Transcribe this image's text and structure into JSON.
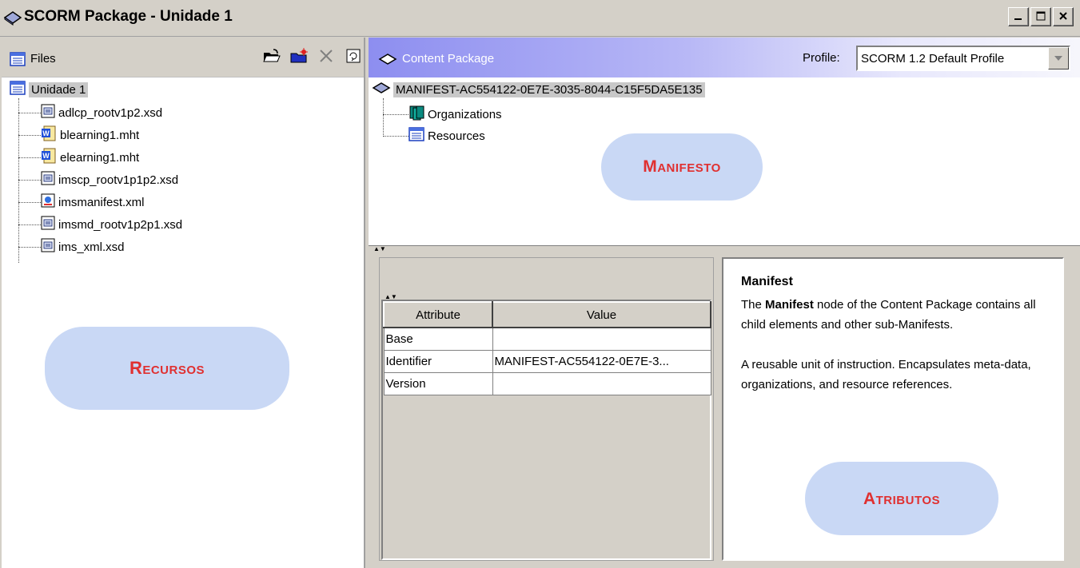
{
  "window": {
    "title": "SCORM Package - Unidade 1",
    "controls": [
      "minimize",
      "maximize",
      "close"
    ]
  },
  "files_panel": {
    "header_label": "Files",
    "toolbar": [
      "import-folder-icon",
      "new-folder-icon",
      "delete-icon",
      "refresh-icon"
    ],
    "root": "Unidade 1",
    "items": [
      {
        "name": "adlcp_rootv1p2.xsd",
        "icon": "xsd-file-icon"
      },
      {
        "name": "blearning1.mht",
        "icon": "word-doc-icon"
      },
      {
        "name": "elearning1.mht",
        "icon": "word-doc-icon"
      },
      {
        "name": "imscp_rootv1p1p2.xsd",
        "icon": "xsd-file-icon"
      },
      {
        "name": "imsmanifest.xml",
        "icon": "xml-file-icon"
      },
      {
        "name": "imsmd_rootv1p2p1.xsd",
        "icon": "xsd-file-icon"
      },
      {
        "name": "ims_xml.xsd",
        "icon": "xsd-file-icon"
      }
    ],
    "callout": "Recursos"
  },
  "content_package": {
    "header_label": "Content Package",
    "profile_label": "Profile:",
    "profile_value": "SCORM 1.2 Default Profile",
    "manifest_root": "MANIFEST-AC554122-0E7E-3035-8044-C15F5DA5E135",
    "children": [
      "Organizations",
      "Resources"
    ],
    "callout": "Manifesto"
  },
  "attributes": {
    "columns": [
      "Attribute",
      "Value"
    ],
    "rows": [
      {
        "attribute": "Base",
        "value": ""
      },
      {
        "attribute": "Identifier",
        "value": "MANIFEST-AC554122-0E7E-3..."
      },
      {
        "attribute": "Version",
        "value": ""
      }
    ]
  },
  "description": {
    "title": "Manifest",
    "para1_pre": "The ",
    "para1_bold": "Manifest",
    "para1_post": " node of the Content Package contains all child elements and other sub-Manifests.",
    "para2": "A reusable unit of instruction. Encapsulates meta-data, organizations, and resource references.",
    "callout": "Atributos"
  },
  "colors": {
    "callout_fill": "#c9d8f5",
    "callout_text": "#e03030",
    "header_gradient_start": "#8d8ef0"
  }
}
